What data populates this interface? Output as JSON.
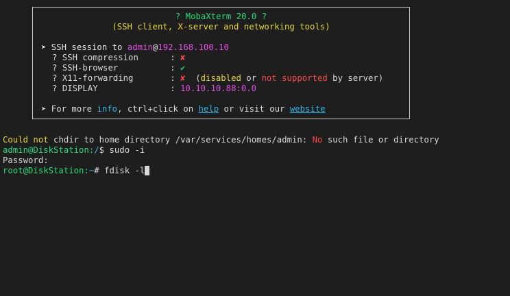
{
  "banner": {
    "title": "? MobaXterm 20.0 ?",
    "subtitle": "(SSH client, X-server and networking tools)",
    "session": {
      "prefix": "➤ SSH session to ",
      "user": "admin",
      "at": "@",
      "host": "192.168.100.10"
    },
    "features": [
      {
        "bullet": "? ",
        "label": "SSH compression",
        "sep": " : ",
        "status": "✘"
      },
      {
        "bullet": "? ",
        "label": "SSH-browser",
        "sep": " : ",
        "status": "✔"
      },
      {
        "bullet": "? ",
        "label": "X11-forwarding",
        "sep": " : ",
        "status": "✘"
      },
      {
        "bullet": "? ",
        "label": "DISPLAY",
        "sep": " : ",
        "status": "10.10.10.88:0.0"
      }
    ],
    "x11_note": {
      "open": "  (",
      "disabled": "disabled",
      "or": " or ",
      "not_supported": "not supported",
      "by_server": " by server)"
    },
    "more": {
      "prefix": "➤ For more ",
      "info": "info",
      "ctrl": ", ctrl+click on ",
      "help": "help",
      "visit": " or visit our ",
      "website": "website"
    }
  },
  "output": {
    "line1": {
      "could_not": "Could not",
      "chdir": " chdir to home directory /var/services/homes/admin: ",
      "no": "No",
      "rest": " such file or directory"
    },
    "line2": {
      "prompt_user": "admin@DiskStation:",
      "prompt_path": "/",
      "prompt_symbol": "$ ",
      "command": "sudo -i"
    },
    "line3": {
      "text": "Password:"
    },
    "line4": {
      "prompt_user": "root@DiskStation:",
      "prompt_path": "~",
      "prompt_symbol": "# ",
      "command": "fdisk -l"
    }
  },
  "colors": {
    "background": "#1e1e1e",
    "text": "#d8d8d8",
    "green": "#2bd97a",
    "yellow": "#e6d63b",
    "magenta": "#e04de0",
    "red": "#ff4a4a",
    "cyan": "#31b3e8"
  }
}
